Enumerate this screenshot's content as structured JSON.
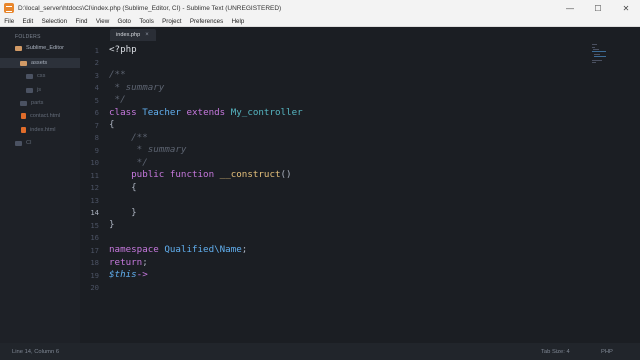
{
  "window": {
    "title": "D:\\local_server\\htdocs\\CI\\index.php (Sublime_Editor, CI) - Sublime Text (UNREGISTERED)",
    "minimize": "—",
    "maximize": "☐",
    "close": "✕"
  },
  "menu": [
    "File",
    "Edit",
    "Selection",
    "Find",
    "View",
    "Goto",
    "Tools",
    "Project",
    "Preferences",
    "Help"
  ],
  "sidebar": {
    "header": "FOLDERS",
    "items": [
      {
        "label": "Sublime_Editor",
        "type": "folder"
      },
      {
        "label": "assets",
        "type": "folder"
      },
      {
        "label": "css",
        "type": "folder"
      },
      {
        "label": "js",
        "type": "folder"
      },
      {
        "label": "parts",
        "type": "folder"
      },
      {
        "label": "contact.html",
        "type": "file"
      },
      {
        "label": "index.html",
        "type": "file"
      },
      {
        "label": "CI",
        "type": "folder"
      }
    ]
  },
  "tabs": [
    {
      "label": "index.php",
      "close": "×"
    }
  ],
  "editor": {
    "line_numbers": [
      "1",
      "2",
      "3",
      "4",
      "5",
      "6",
      "7",
      "8",
      "9",
      "10",
      "11",
      "12",
      "13",
      "14",
      "15",
      "16",
      "17",
      "18",
      "19",
      "20"
    ],
    "active_line": "14",
    "code": [
      {
        "n": "1",
        "tokens": [
          {
            "t": "<?php",
            "c": "tag"
          }
        ]
      },
      {
        "n": "2",
        "tokens": []
      },
      {
        "n": "3",
        "tokens": [
          {
            "t": "/**",
            "c": "comment"
          }
        ]
      },
      {
        "n": "4",
        "tokens": [
          {
            "t": " * summary",
            "c": "comment"
          }
        ]
      },
      {
        "n": "5",
        "tokens": [
          {
            "t": " */",
            "c": "comment"
          }
        ]
      },
      {
        "n": "6",
        "tokens": [
          {
            "t": "class ",
            "c": "keyword"
          },
          {
            "t": "Teacher",
            "c": "class"
          },
          {
            "t": " extends ",
            "c": "keyword"
          },
          {
            "t": "My_controller",
            "c": "parent"
          }
        ]
      },
      {
        "n": "7",
        "tokens": [
          {
            "t": "{",
            "c": "plain"
          }
        ]
      },
      {
        "n": "8",
        "tokens": [
          {
            "t": "    /**",
            "c": "comment"
          }
        ]
      },
      {
        "n": "9",
        "tokens": [
          {
            "t": "     * summary",
            "c": "comment"
          }
        ]
      },
      {
        "n": "10",
        "tokens": [
          {
            "t": "     */",
            "c": "comment"
          }
        ]
      },
      {
        "n": "11",
        "tokens": [
          {
            "t": "    public ",
            "c": "keyword"
          },
          {
            "t": "function ",
            "c": "keyword"
          },
          {
            "t": "__construct",
            "c": "func"
          },
          {
            "t": "()",
            "c": "plain"
          }
        ]
      },
      {
        "n": "12",
        "tokens": [
          {
            "t": "    {",
            "c": "plain"
          }
        ]
      },
      {
        "n": "13",
        "tokens": []
      },
      {
        "n": "14",
        "tokens": [
          {
            "t": "    }",
            "c": "plain"
          }
        ]
      },
      {
        "n": "15",
        "tokens": [
          {
            "t": "}",
            "c": "plain"
          }
        ]
      },
      {
        "n": "16",
        "tokens": []
      },
      {
        "n": "17",
        "tokens": [
          {
            "t": "namespace ",
            "c": "keyword"
          },
          {
            "t": "Qualified\\Name",
            "c": "class"
          },
          {
            "t": ";",
            "c": "plain"
          }
        ]
      },
      {
        "n": "18",
        "tokens": [
          {
            "t": "return",
            "c": "keyword"
          },
          {
            "t": ";",
            "c": "plain"
          }
        ]
      },
      {
        "n": "19",
        "tokens": [
          {
            "t": "$this",
            "c": "this"
          },
          {
            "t": "->",
            "c": "keyword"
          }
        ]
      },
      {
        "n": "20",
        "tokens": []
      }
    ]
  },
  "status": {
    "position": "Line 14, Column 6",
    "tab_size": "Tab Size: 4",
    "syntax": "PHP"
  },
  "colors": {
    "background": "#1b1e23",
    "sidebar": "#1e2127",
    "keyword": "#c678dd",
    "class": "#61afef",
    "comment": "#5c6370",
    "function": "#e5c07b"
  }
}
